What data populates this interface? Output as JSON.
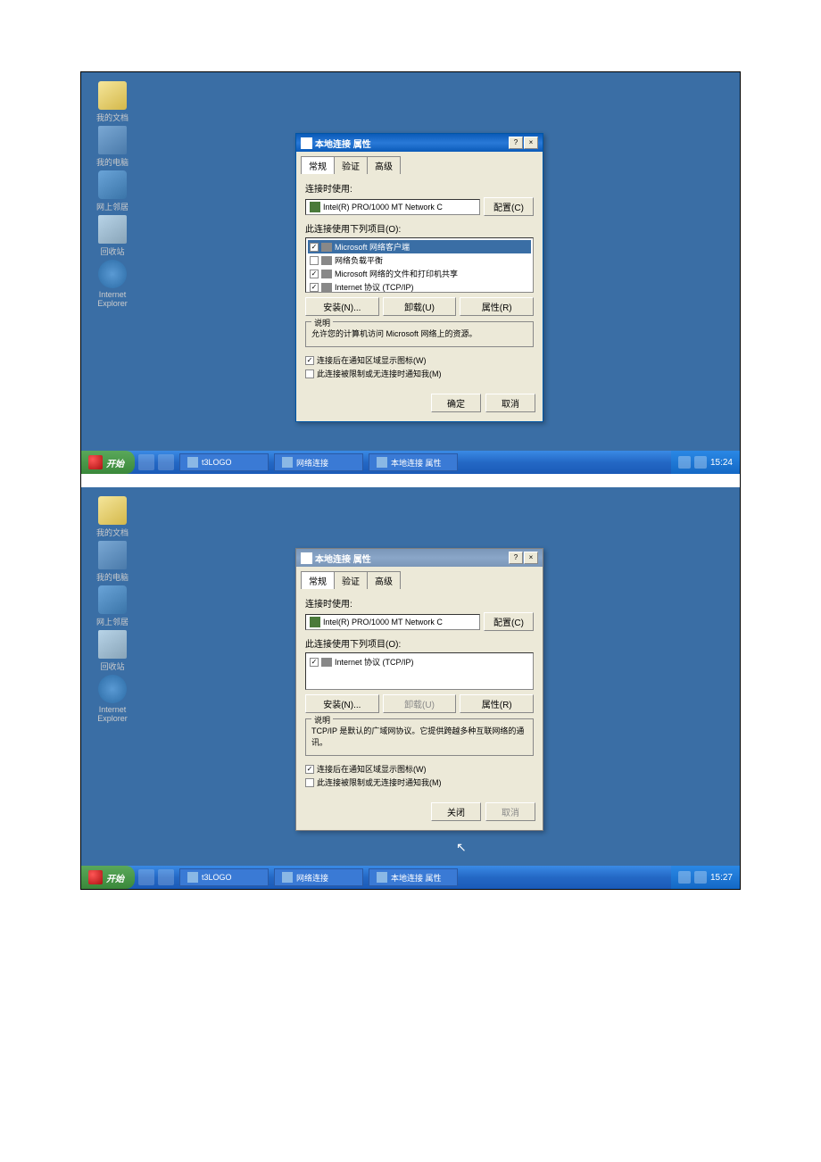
{
  "icons": {
    "my_docs": "我的文档",
    "my_computer": "我的电脑",
    "network": "网上邻居",
    "recycle": "回收站",
    "ie": "Internet Explorer"
  },
  "screenshot1": {
    "dialog_title": "本地连接 属性",
    "tab_general": "常规",
    "tab_auth": "验证",
    "tab_advanced": "高级",
    "connect_using": "连接时使用:",
    "device": "Intel(R) PRO/1000 MT Network C",
    "btn_configure": "配置(C)",
    "items_label": "此连接使用下列项目(O):",
    "items": [
      {
        "label": "Microsoft 网络客户端",
        "checked": true,
        "selected": true
      },
      {
        "label": "网络负载平衡",
        "checked": false,
        "selected": false
      },
      {
        "label": "Microsoft 网络的文件和打印机共享",
        "checked": true,
        "selected": false
      },
      {
        "label": "Internet 协议 (TCP/IP)",
        "checked": true,
        "selected": false
      }
    ],
    "btn_install": "安装(N)...",
    "btn_uninstall": "卸载(U)",
    "btn_properties": "属性(R)",
    "desc_title": "说明",
    "desc_text": "允许您的计算机访问 Microsoft 网络上的资源。",
    "chk_show_icon": "连接后在通知区域显示图标(W)",
    "chk_notify": "此连接被限制或无连接时通知我(M)",
    "btn_ok": "确定",
    "btn_cancel": "取消",
    "taskbar": {
      "start": "开始",
      "task1": "网络连接",
      "task2": "本地连接 属性",
      "time": "15:24"
    }
  },
  "screenshot2": {
    "dialog_title": "本地连接 属性",
    "tab_general": "常规",
    "tab_auth": "验证",
    "tab_advanced": "高级",
    "connect_using": "连接时使用:",
    "device": "Intel(R) PRO/1000 MT Network C",
    "btn_configure": "配置(C)",
    "items_label": "此连接使用下列项目(O):",
    "items": [
      {
        "label": "Internet 协议 (TCP/IP)",
        "checked": true,
        "selected": false
      }
    ],
    "btn_install": "安装(N)...",
    "btn_uninstall": "卸载(U)",
    "btn_properties": "属性(R)",
    "desc_title": "说明",
    "desc_text": "TCP/IP 是默认的广域网协议。它提供跨越多种互联网络的通讯。",
    "chk_show_icon": "连接后在通知区域显示图标(W)",
    "chk_notify": "此连接被限制或无连接时通知我(M)",
    "btn_close": "关闭",
    "btn_cancel": "取消",
    "taskbar": {
      "start": "开始",
      "task1": "网络连接",
      "task2": "本地连接 属性",
      "time": "15:27"
    },
    "folder": "t3LOGO",
    "folder1": "t3LOGO"
  },
  "folder1": "t3LOGO",
  "folder2": "t3LOGO"
}
